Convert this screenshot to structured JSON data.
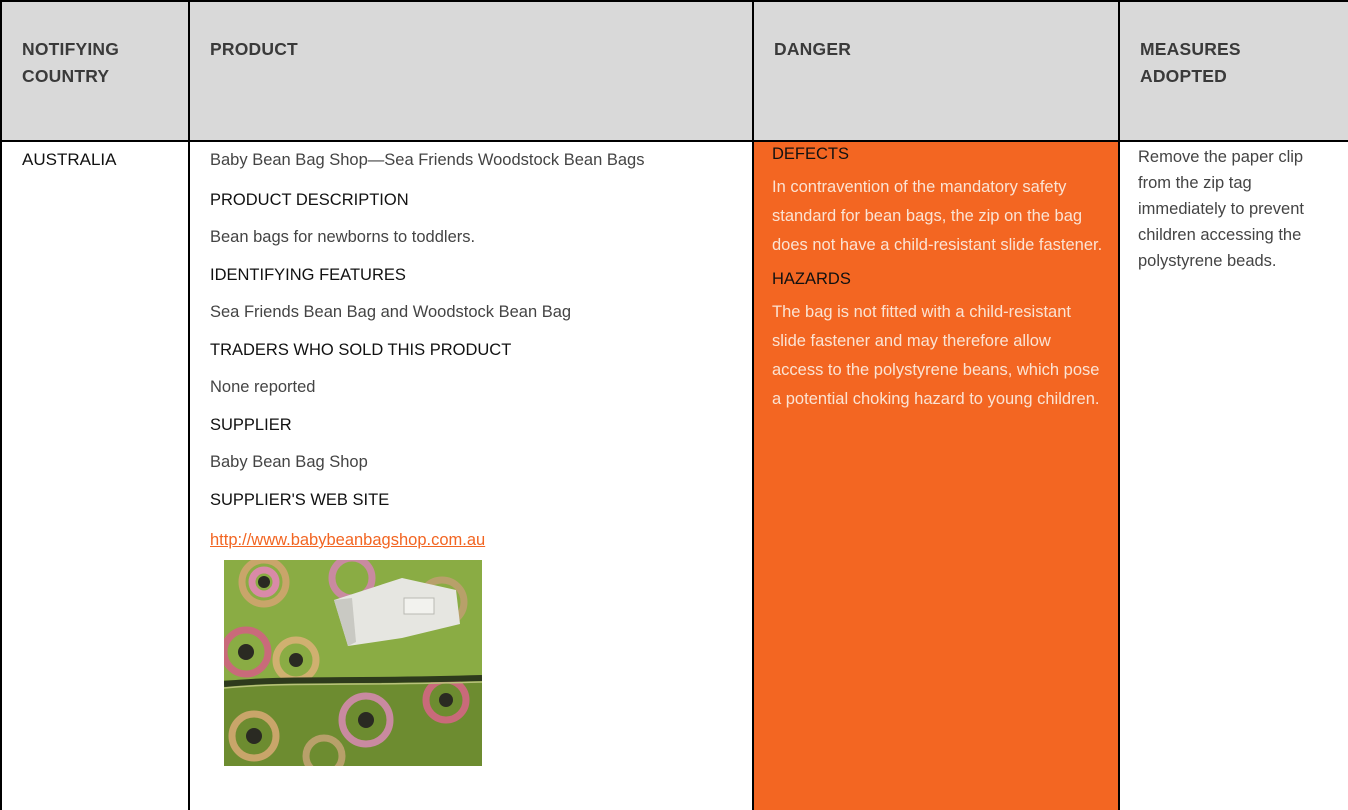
{
  "headers": {
    "country": "NOTIFYING COUNTRY",
    "product": "PRODUCT",
    "danger": "DANGER",
    "measures": "MEASURES ADOPTED"
  },
  "country": "AUSTRALIA",
  "product": {
    "title": "Baby Bean Bag Shop—Sea Friends Woodstock Bean Bags",
    "description_heading": "PRODUCT DESCRIPTION",
    "description": "Bean bags for newborns to toddlers.",
    "features_heading": "IDENTIFYING FEATURES",
    "features": "Sea Friends Bean Bag and Woodstock Bean Bag",
    "traders_heading": "TRADERS WHO SOLD THIS PRODUCT",
    "traders": "None reported",
    "supplier_heading": "SUPPLIER",
    "supplier": "Baby Bean Bag Shop",
    "website_heading": "SUPPLIER'S WEB SITE",
    "website": "http://www.babybeanbagshop.com.au"
  },
  "danger": {
    "defects_heading": "DEFECTS",
    "defects": "In contravention of the mandatory safety standard for bean bags, the zip on the bag does not have a child-resistant slide fastener.",
    "hazards_heading": "HAZARDS",
    "hazards": "The bag is not fitted with a child-resistant slide fastener and may therefore allow access to the polystyrene beans, which pose a potential choking hazard to young children."
  },
  "measures": "Remove the paper clip from the zip tag immediately to prevent children accessing the polystyrene beads.",
  "colors": {
    "header_bg": "#d9d9d9",
    "danger_bg": "#f36622",
    "link": "#f26522"
  }
}
